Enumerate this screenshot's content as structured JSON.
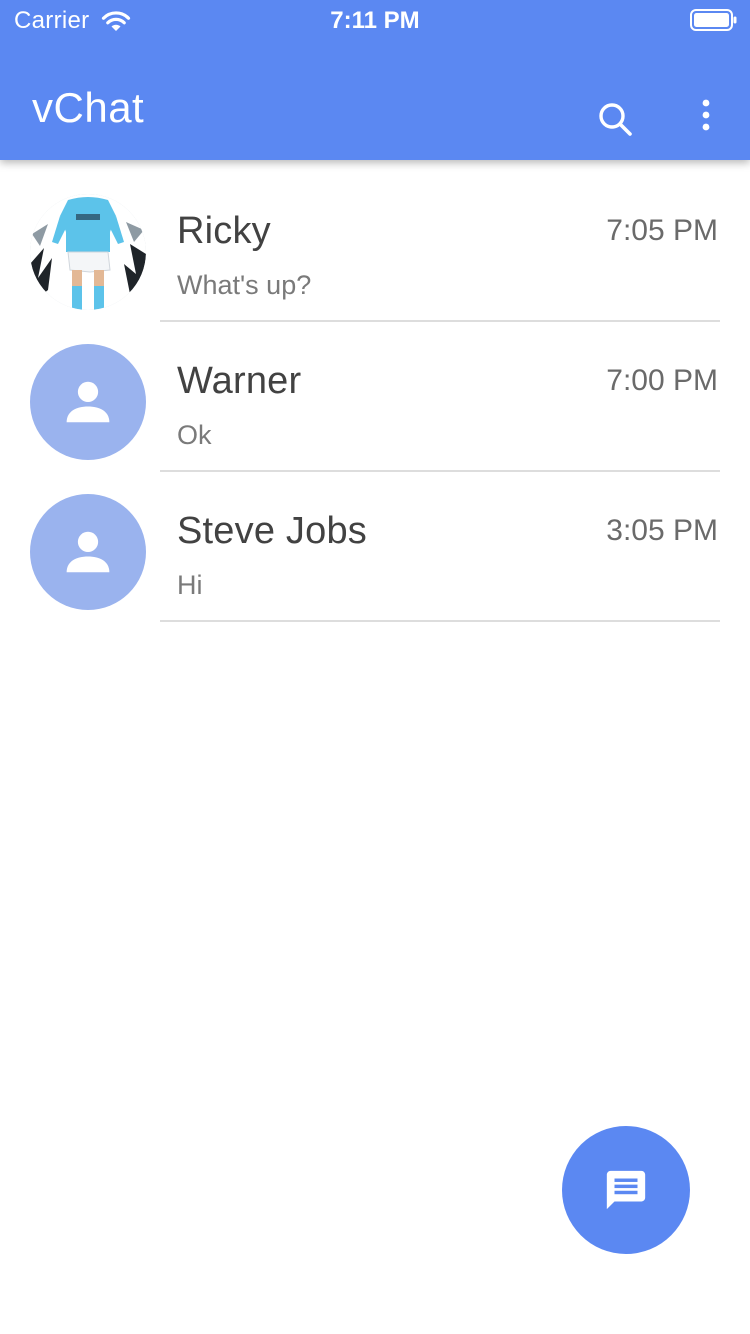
{
  "status_bar": {
    "carrier": "Carrier",
    "time": "7:11 PM",
    "wifi_icon": "wifi-icon",
    "battery_icon": "battery-icon"
  },
  "app_bar": {
    "title": "vChat",
    "search_icon": "search-icon",
    "more_icon": "more-vertical-icon"
  },
  "chats": [
    {
      "name": "Ricky",
      "time": "7:05 PM",
      "preview": "What's up?",
      "avatar": "photo"
    },
    {
      "name": "Warner",
      "time": "7:00 PM",
      "preview": "Ok",
      "avatar": "person-icon"
    },
    {
      "name": "Steve Jobs",
      "time": "3:05 PM",
      "preview": "Hi",
      "avatar": "person-icon"
    }
  ],
  "fab": {
    "icon": "message-icon"
  },
  "colors": {
    "primary": "#5b88f2",
    "avatar_placeholder": "#9ab3ee",
    "name_text": "#424242",
    "secondary_text": "#7a7a7a",
    "divider": "#dddddd"
  }
}
